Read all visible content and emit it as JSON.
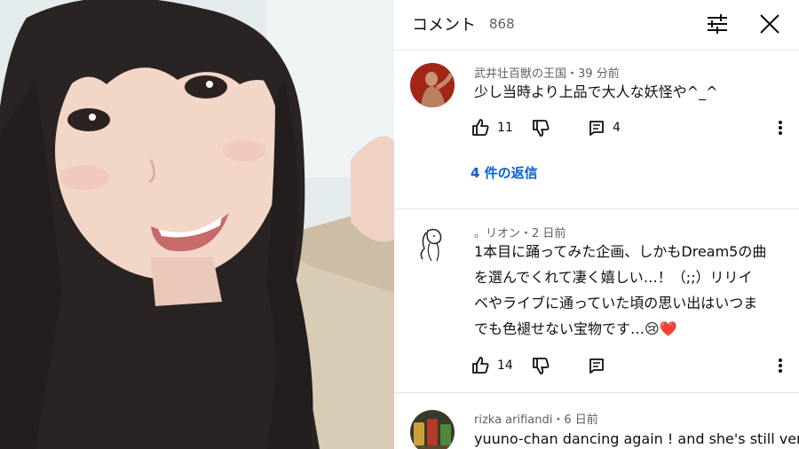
{
  "header": {
    "title": "コメント",
    "count": "868"
  },
  "comments": [
    {
      "author": "武井壮百獣の王国",
      "time": "39 分前",
      "text_lines": [
        "少し当時より上品で大人な妖怪や^_^"
      ],
      "likes": "11",
      "reply_count": "4",
      "replies_link": "4 件の返信"
    },
    {
      "author": "。リオン",
      "time": "2 日前",
      "text_lines": [
        "1本目に踊ってみた企画、しかもDream5の曲",
        "を選んでくれて凄く嬉しい…！（;;）リリイ",
        "ベやライブに通っていた頃の思い出はいつま",
        "でも色褪せない宝物です…😢❤️"
      ],
      "likes": "14"
    },
    {
      "author": "rizka arifiandi",
      "time": "6 日前",
      "text_lines": [
        "yuuno-chan dancing again ! and she's still very"
      ]
    }
  ],
  "meta_separator": "・",
  "colors": {
    "link_blue": "#065fd4",
    "meta_gray": "#606060",
    "divider": "#e5e5e5"
  },
  "icons": [
    "filter-sliders-icon",
    "close-icon",
    "thumbs-up-icon",
    "thumbs-down-icon",
    "reply-icon",
    "more-vert-icon"
  ]
}
